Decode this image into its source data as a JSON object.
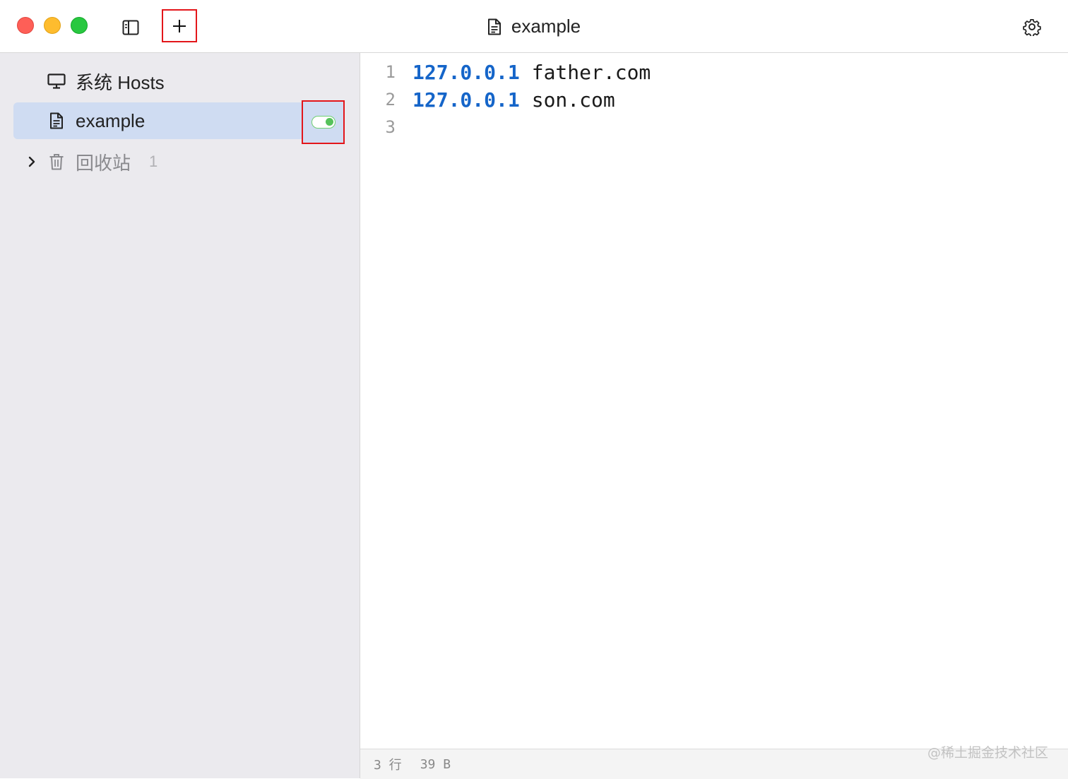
{
  "window": {
    "title": "example",
    "icons": [
      "close-button",
      "minimize-button",
      "zoom-button",
      "sidebar-toggle-icon",
      "plus-icon",
      "document-icon",
      "gear-icon"
    ]
  },
  "sidebar": {
    "items": [
      {
        "label": "系统 Hosts",
        "icon": "monitor-icon"
      },
      {
        "label": "example",
        "icon": "document-icon",
        "enabled": true
      },
      {
        "label": "回收站",
        "icon": "trash-icon",
        "count": "1",
        "collapsed": true
      }
    ]
  },
  "editor": {
    "lines": [
      {
        "number": "1",
        "ip": "127.0.0.1",
        "host": "father.com"
      },
      {
        "number": "2",
        "ip": "127.0.0.1",
        "host": "son.com"
      },
      {
        "number": "3",
        "ip": "",
        "host": ""
      }
    ]
  },
  "status": {
    "lines": "3 行",
    "size": "39 B"
  },
  "watermark": "@稀土掘金技术社区",
  "colors": {
    "accent_ip": "#1565c9",
    "selection": "#cfdcf2",
    "toggle_on": "#56c25b",
    "highlight_box": "#e3161a"
  }
}
